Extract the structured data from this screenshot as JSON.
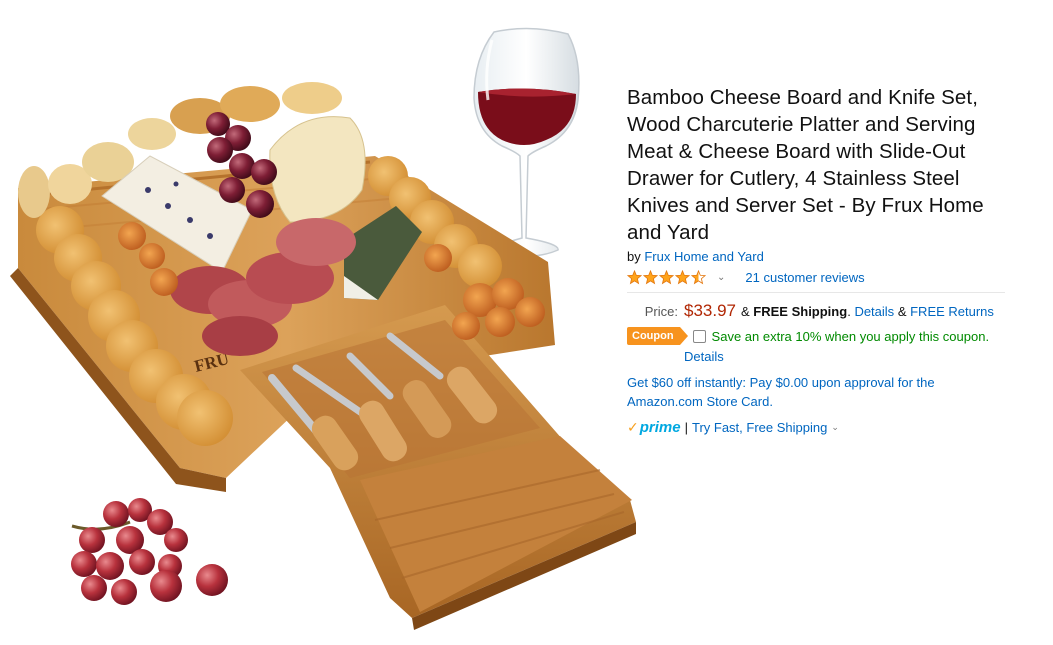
{
  "product": {
    "title": "Bamboo Cheese Board and Knife Set, Wood Charcuterie Platter and Serving Meat & Cheese Board with Slide-Out Drawer for Cutlery, 4 Stainless Steel Knives and Server Set - By Frux Home and Yard",
    "by_label": "by",
    "brand": "Frux Home and Yard",
    "rating": 4.5,
    "rating_max": 5,
    "reviews_link": "21 customer reviews",
    "caret_icon": "chevron-down-icon",
    "image_brand_mark": "FRU"
  },
  "pricing": {
    "label": "Price:",
    "value": "$33.97",
    "amp1": "&",
    "free_shipping": "FREE Shipping",
    "period": ".",
    "details_link": "Details",
    "amp2": "&",
    "free_returns_link": "FREE Returns"
  },
  "coupon": {
    "badge": "Coupon",
    "checked": false,
    "text": "Save an extra 10% when you apply this coupon.",
    "details_link": "Details"
  },
  "promo": {
    "text": "Get $60 off instantly: Pay $0.00 upon approval for the Amazon.com Store Card."
  },
  "prime": {
    "check": "✓",
    "logo": "prime",
    "separator": "|",
    "link": "Try Fast, Free Shipping",
    "caret": "⌄"
  },
  "colors": {
    "link": "#0066c0",
    "price": "#b12704",
    "coupon_badge": "#f7931e",
    "coupon_text": "#008a00",
    "star": "#ffa41c",
    "prime_blue": "#00a8e1"
  }
}
